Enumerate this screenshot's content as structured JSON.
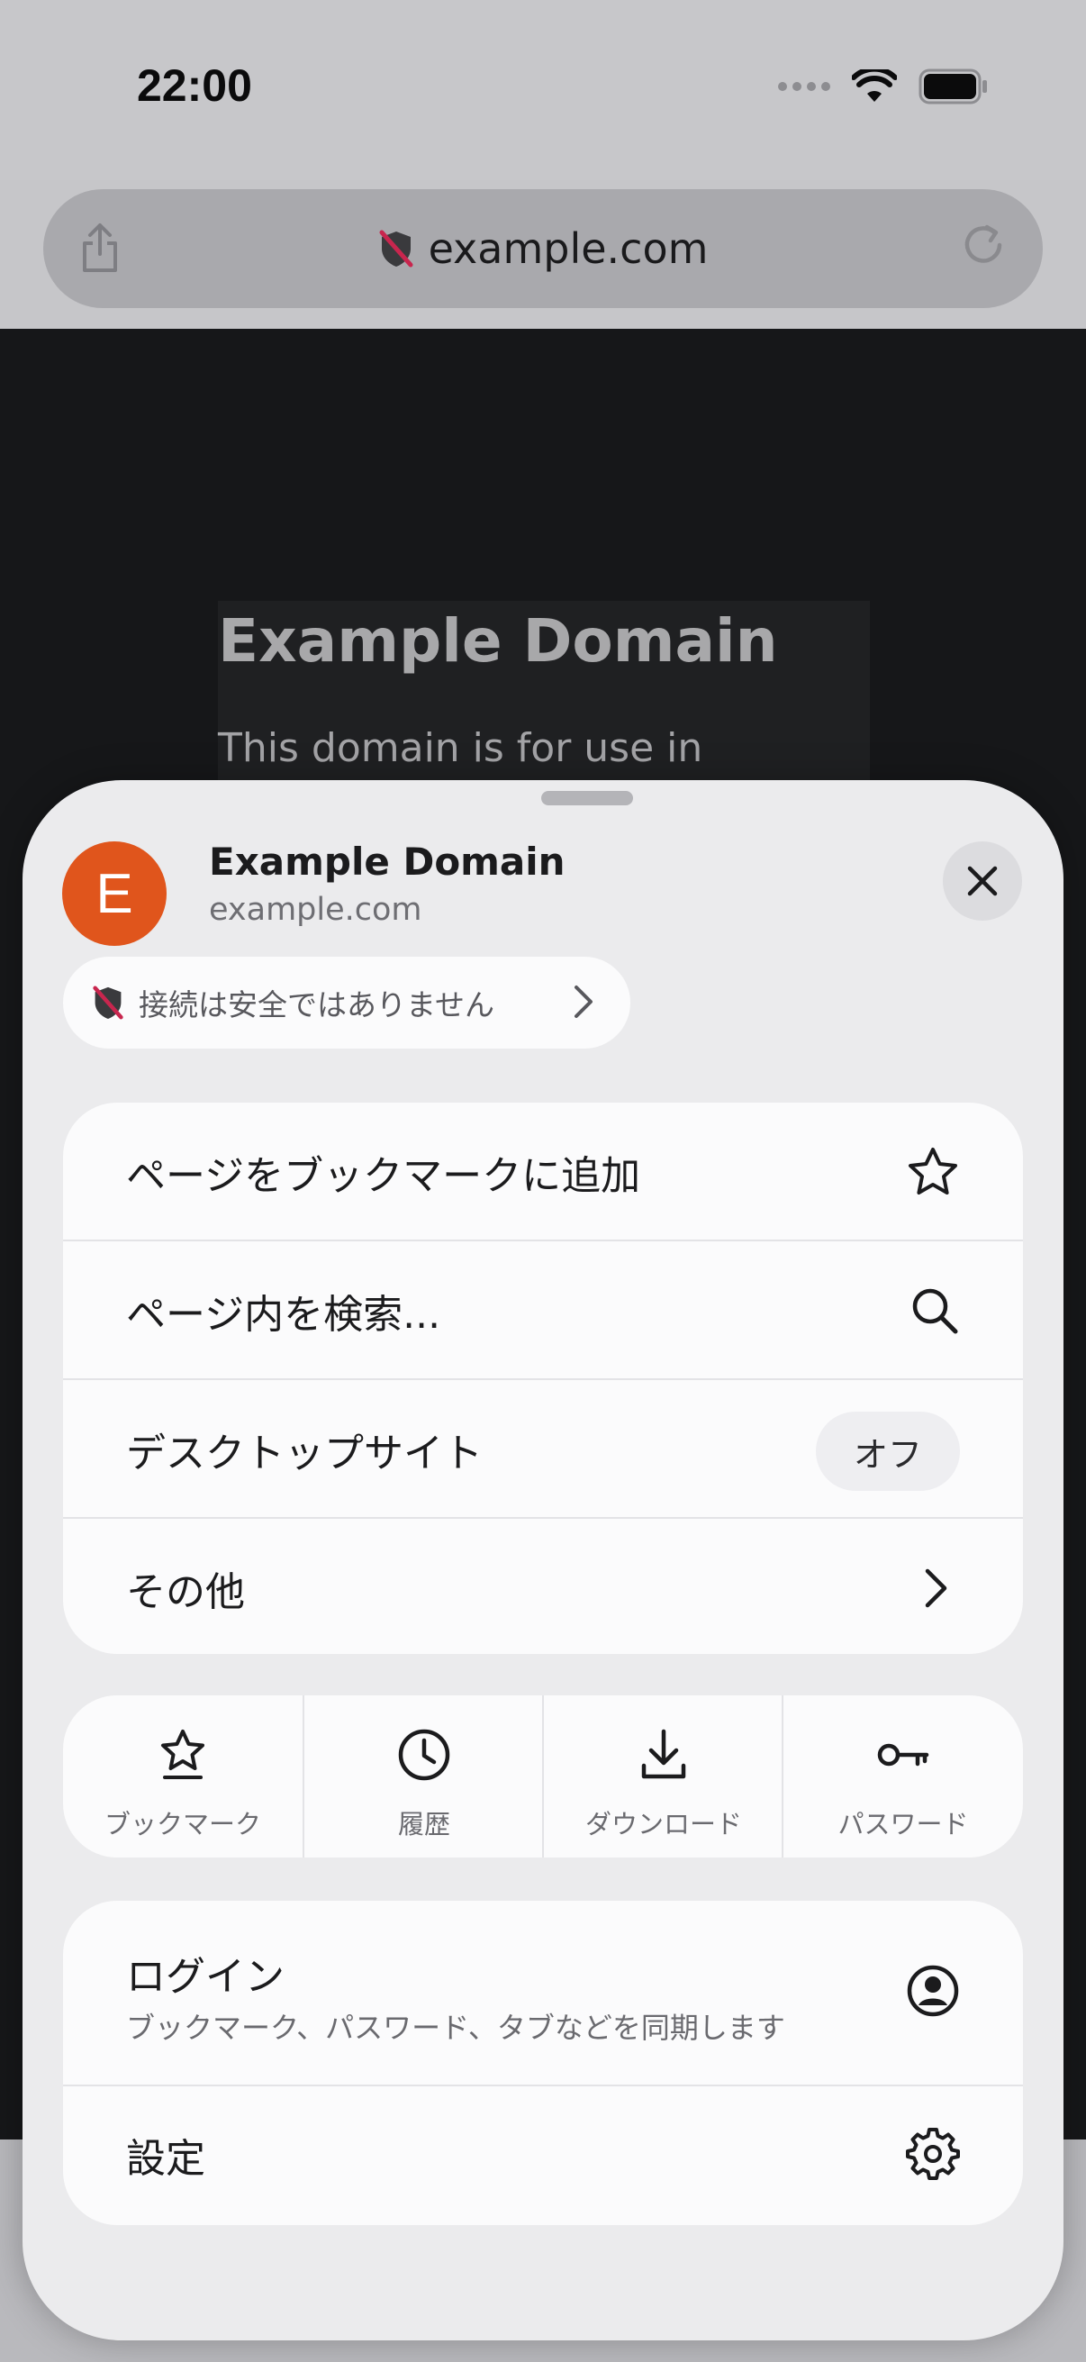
{
  "status_bar": {
    "time": "22:00",
    "icons": [
      "signal-dots-icon",
      "wifi-icon",
      "battery-icon"
    ]
  },
  "url_bar": {
    "url": "example.com",
    "left_icon": "share-icon",
    "right_icon": "reload-icon",
    "security_icon": "insecure-shield-icon"
  },
  "page": {
    "heading": "Example Domain",
    "body": "This domain is for use in"
  },
  "sheet": {
    "site": {
      "avatar_letter": "E",
      "title": "Example Domain",
      "url": "example.com"
    },
    "security": {
      "label": "接続は安全ではありません"
    },
    "menu": [
      {
        "label": "ページをブックマークに追加",
        "icon": "star-icon"
      },
      {
        "label": "ページ内を検索...",
        "icon": "search-icon"
      },
      {
        "label": "デスクトップサイト",
        "toggle": "オフ"
      },
      {
        "label": "その他",
        "icon": "chevron-right-icon"
      }
    ],
    "quick_actions": [
      {
        "label": "ブックマーク",
        "icon": "bookmark-star-icon"
      },
      {
        "label": "履歴",
        "icon": "clock-icon"
      },
      {
        "label": "ダウンロード",
        "icon": "download-icon"
      },
      {
        "label": "パスワード",
        "icon": "key-icon"
      }
    ],
    "account": {
      "login_title": "ログイン",
      "login_subtitle": "ブックマーク、パスワード、タブなどを同期します",
      "settings_label": "設定"
    }
  },
  "colors": {
    "avatar": "#e0551c",
    "insecure": "#c8264e"
  }
}
